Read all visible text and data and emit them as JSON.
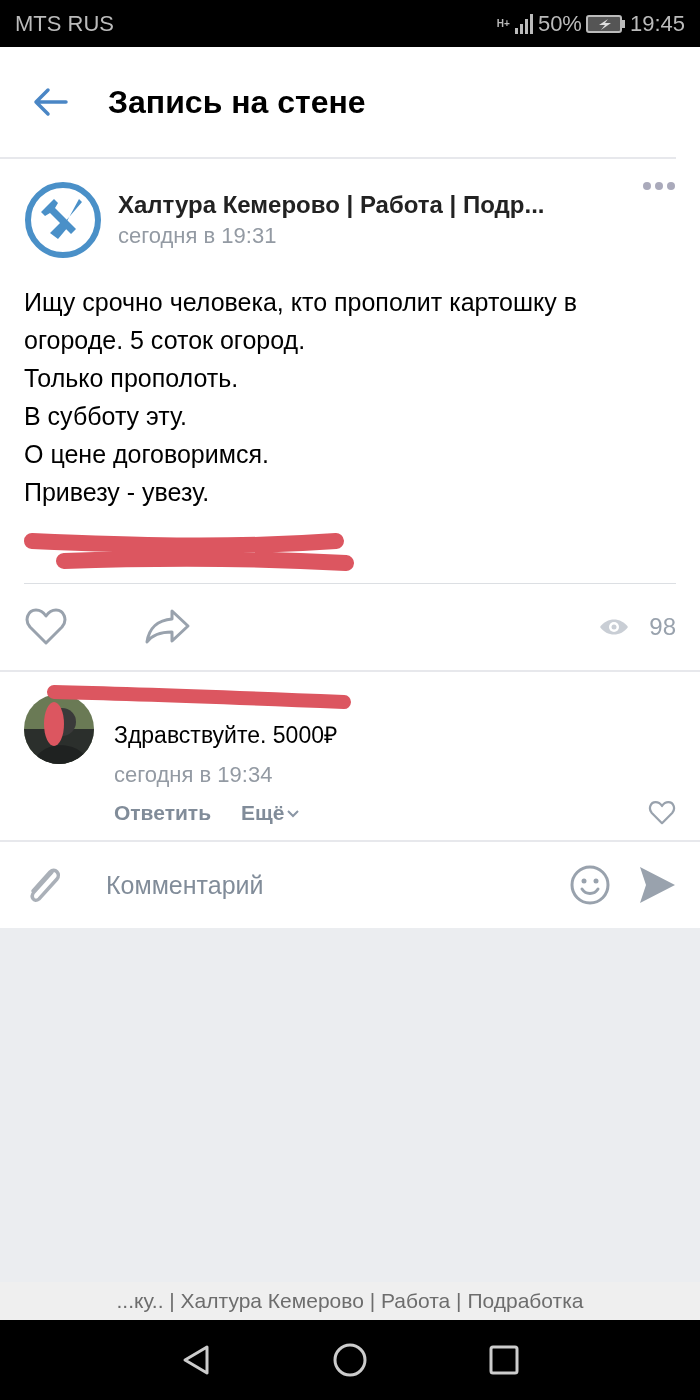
{
  "status_bar": {
    "carrier": "MTS RUS",
    "network": "H+",
    "battery": "50%",
    "time": "19:45"
  },
  "header": {
    "title": "Запись на стене"
  },
  "post": {
    "author": "Халтура Кемерово | Работа | Подр...",
    "time": "сегодня в 19:31",
    "lines": [
      "Ищу срочно человека, кто прополит картошку в огороде. 5 соток огород.",
      "Только прополоть.",
      "В субботу эту.",
      "О цене договоримся.",
      "Привезу - увезу."
    ],
    "liked": false,
    "views": "98"
  },
  "comments": [
    {
      "text": "Здравствуйте. 5000₽",
      "time": "сегодня в 19:34",
      "reply": "Ответить",
      "more": "Ещё",
      "liked": false
    }
  ],
  "composer": {
    "placeholder": "Комментарий"
  },
  "footer": {
    "caption": "...ку.. | Халтура Кемерово | Работа | Подработка"
  }
}
